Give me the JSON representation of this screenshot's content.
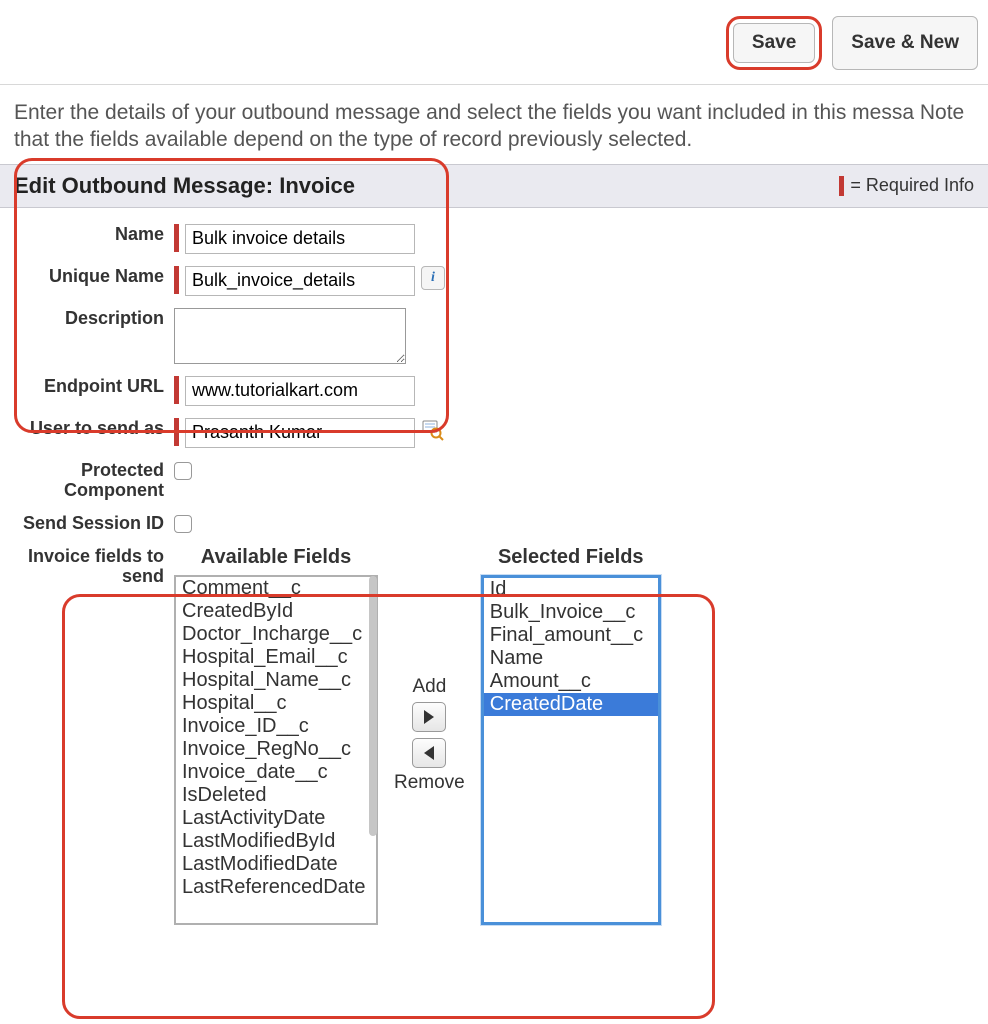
{
  "toolbar": {
    "save": "Save",
    "save_new": "Save & New"
  },
  "intro": "Enter the details of your outbound message and select the fields you want included in this messa Note that the fields available depend on the type of record previously selected.",
  "section": {
    "title": "Edit Outbound Message: Invoice",
    "required_legend": "= Required Info"
  },
  "labels": {
    "name": "Name",
    "unique_name": "Unique Name",
    "description": "Description",
    "endpoint_url": "Endpoint URL",
    "user_to_send": "User to send as",
    "protected": "Protected Component",
    "session_id": "Send Session ID",
    "fields_to_send": "Invoice fields to send"
  },
  "values": {
    "name": "Bulk invoice details",
    "unique_name": "Bulk_invoice_details",
    "description": "",
    "endpoint_url": "www.tutorialkart.com",
    "user_to_send": "Prasanth Kumar"
  },
  "picklist": {
    "available_title": "Available Fields",
    "selected_title": "Selected Fields",
    "add_label": "Add",
    "remove_label": "Remove",
    "available": [
      "Comment__c",
      "CreatedById",
      "Doctor_Incharge__c",
      "Hospital_Email__c",
      "Hospital_Name__c",
      "Hospital__c",
      "Invoice_ID__c",
      "Invoice_RegNo__c",
      "Invoice_date__c",
      "IsDeleted",
      "LastActivityDate",
      "LastModifiedById",
      "LastModifiedDate",
      "LastReferencedDate"
    ],
    "selected": [
      "Id",
      "Bulk_Invoice__c",
      "Final_amount__c",
      "Name",
      "Amount__c",
      "CreatedDate"
    ],
    "selected_highlight": "CreatedDate"
  }
}
